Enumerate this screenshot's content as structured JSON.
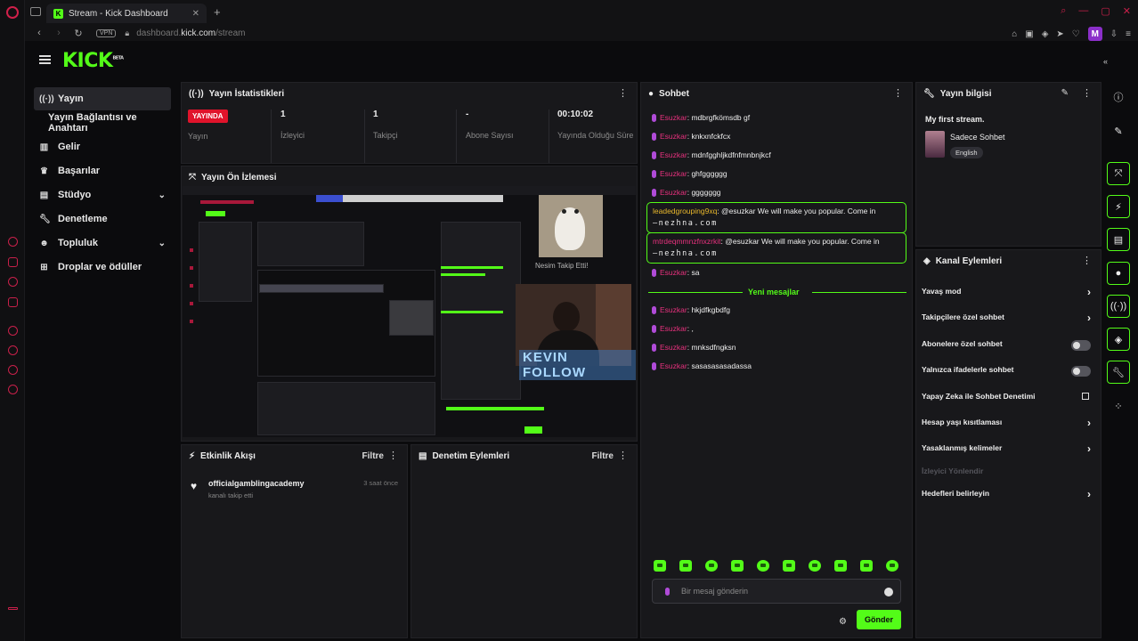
{
  "browser": {
    "tab_title": "Stream - Kick Dashboard",
    "tab_favicon": "K",
    "new_tab": "+",
    "vpn": "VPN",
    "url_prefix": "dashboard.",
    "url_domain": "kick.com",
    "url_path": "/stream",
    "profile_initial": "M"
  },
  "header": {
    "logo": "KICK",
    "logo_tag": "BETA"
  },
  "sidebar": {
    "items": [
      {
        "label": "Yayın",
        "icon": "broadcast-icon"
      },
      {
        "label": "Yayın Bağlantısı ve Anahtarı"
      },
      {
        "label": "Gelir",
        "icon": "chart-icon"
      },
      {
        "label": "Başarılar",
        "icon": "trophy-icon"
      },
      {
        "label": "Stüdyo",
        "icon": "studio-icon"
      },
      {
        "label": "Denetleme",
        "icon": "wrench-icon"
      },
      {
        "label": "Topluluk",
        "icon": "community-icon"
      },
      {
        "label": "Droplar ve ödüller",
        "icon": "gift-icon"
      }
    ]
  },
  "stats": {
    "title": "Yayın İstatistikleri",
    "live_badge": "YAYINDA",
    "items": [
      {
        "label": "Yayın"
      },
      {
        "value": "1",
        "label": "İzleyici"
      },
      {
        "value": "1",
        "label": "Takipçi"
      },
      {
        "value": "-",
        "label": "Abone Sayısı"
      },
      {
        "value": "00:10:02",
        "label": "Yayında Olduğu Süre"
      }
    ]
  },
  "preview": {
    "title": "Yayın Ön İzlemesi",
    "overlay_text": "KEVIN FOLLOW",
    "follow_text": "Nesim Takip Etti!"
  },
  "activity": {
    "title": "Etkinlik Akışı",
    "filter": "Filtre",
    "items": [
      {
        "user": "officialgamblingacademy",
        "sub": "kanalı takip etti",
        "time": "3 saat önce"
      }
    ]
  },
  "moderation": {
    "title": "Denetim Eylemleri",
    "filter": "Filtre"
  },
  "chat": {
    "title": "Sohbet",
    "messages": [
      {
        "user": "Esuzkar",
        "text": ": mdbrgfkömsdb gf"
      },
      {
        "user": "Esuzkar",
        "text": ": knkxnfckfcx"
      },
      {
        "user": "Esuzkar",
        "text": ": mdnfgghljkdfnfmnbnjkcf"
      },
      {
        "user": "Esuzkar",
        "text": ": ghfgggggg"
      },
      {
        "user": "Esuzkar",
        "text": ": ggggggg"
      }
    ],
    "highlighted": [
      {
        "user": "leadedgrouping9xq",
        "text": ": @esuzkar We will make you popular. Come in",
        "link": "—nezhna.com"
      },
      {
        "user": "mtrdeqmmnzfnxzrkit",
        "text": ": @esuzkar We will make you popular. Come in",
        "link": "—nezhna.com"
      }
    ],
    "after_highlight": {
      "user": "Esuzkar",
      "text": ": sa"
    },
    "new_messages_label": "Yeni mesajlar",
    "new_messages": [
      {
        "user": "Esuzkar",
        "text": ": hkjdfkgbdfg"
      },
      {
        "user": "Esuzkar",
        "text": ": ,"
      },
      {
        "user": "Esuzkar",
        "text": ": mnksdfngksn"
      },
      {
        "user": "Esuzkar",
        "text": ": sasasasasadassa"
      }
    ],
    "input_placeholder": "Bir mesaj gönderin",
    "send_label": "Gönder"
  },
  "stream_info": {
    "title": "Yayın bilgisi",
    "stream_title": "My first stream.",
    "category": "Sadece Sohbet",
    "language": "English"
  },
  "channel_actions": {
    "title": "Kanal Eylemleri",
    "items": [
      {
        "label": "Yavaş mod",
        "control": "chevron"
      },
      {
        "label": "Takipçilere özel sohbet",
        "control": "chevron"
      },
      {
        "label": "Abonelere özel sohbet",
        "control": "toggle",
        "state": "off"
      },
      {
        "label": "Yalnızca ifadelerle sohbet",
        "control": "toggle",
        "state": "off"
      },
      {
        "label": "Yapay Zeka ile Sohbet Denetimi",
        "control": "external"
      },
      {
        "label": "Hesap yaşı kısıtlaması",
        "control": "chevron"
      },
      {
        "label": "Yasaklanmış kelimeler",
        "control": "chevron"
      },
      {
        "label": "İzleyici Yönlendir",
        "control": "none",
        "disabled": true
      },
      {
        "label": "Hedefleri belirleyin",
        "control": "chevron"
      }
    ]
  },
  "colors": {
    "accent": "#53fc18",
    "live": "#e0132b",
    "username": "#e8317e",
    "opera": "#c8204a"
  }
}
